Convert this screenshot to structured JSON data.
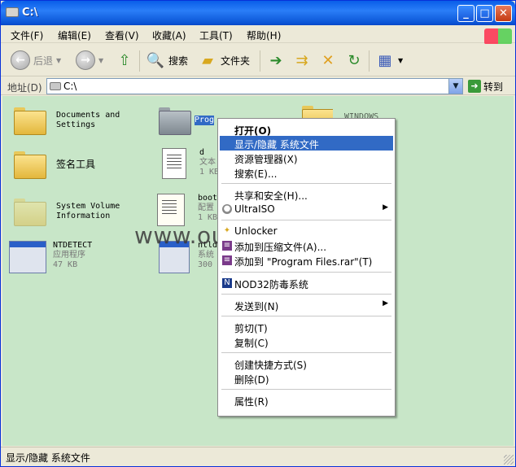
{
  "window": {
    "title": "C:\\",
    "minimize": "_",
    "maximize": "□",
    "close": "✕"
  },
  "menu": [
    "文件(F)",
    "编辑(E)",
    "查看(V)",
    "收藏(A)",
    "工具(T)",
    "帮助(H)"
  ],
  "toolbar": {
    "back": "后退",
    "search": "搜索",
    "folders": "文件夹"
  },
  "address": {
    "label": "地址(D)",
    "value": "C:\\",
    "go": "转到"
  },
  "items": [
    {
      "name": "Documents and Settings",
      "line1": "Documents and",
      "line2": "Settings"
    },
    {
      "name": "Program Files",
      "line1": "Prog"
    },
    {
      "name": "WINDOWS",
      "line1": "WINDOWS"
    },
    {
      "name": "签名工具",
      "line1": "签名工具"
    },
    {
      "name": "d",
      "line1": "d",
      "line2": "文本",
      "line3": "1 KB"
    },
    {
      "name": "System Volume Information",
      "line1": "System Volume",
      "line2": "Information"
    },
    {
      "name": "boot",
      "line1": "boot",
      "line2": "配置",
      "line3": "1 KB"
    },
    {
      "name": "NTDETECT",
      "line1": "NTDETECT",
      "line2": "应用程序",
      "line3": "47 KB"
    },
    {
      "name": "ntldr",
      "line1": "ntld",
      "line2": "系统",
      "line3": "300"
    }
  ],
  "watermark": "www.ouyaoxiazai.com",
  "context_menu": [
    {
      "label": "打开(O)",
      "bold": true
    },
    {
      "label": "显示/隐藏 系统文件",
      "highlighted": true
    },
    {
      "label": "资源管理器(X)"
    },
    {
      "label": "搜索(E)..."
    },
    {
      "sep": true
    },
    {
      "label": "共享和安全(H)..."
    },
    {
      "label": "UltraISO",
      "submenu": true,
      "icon": "ultraiso-icon"
    },
    {
      "sep": true
    },
    {
      "label": "Unlocker",
      "icon": "unlocker-icon"
    },
    {
      "label": "添加到压缩文件(A)...",
      "icon": "winrar-icon"
    },
    {
      "label": "添加到 \"Program Files.rar\"(T)",
      "icon": "winrar-icon"
    },
    {
      "sep": true
    },
    {
      "label": "NOD32防毒系统",
      "icon": "nod32-icon"
    },
    {
      "sep": true
    },
    {
      "label": "发送到(N)",
      "submenu": true
    },
    {
      "sep": true
    },
    {
      "label": "剪切(T)"
    },
    {
      "label": "复制(C)"
    },
    {
      "sep": true
    },
    {
      "label": "创建快捷方式(S)"
    },
    {
      "label": "删除(D)"
    },
    {
      "sep": true
    },
    {
      "label": "属性(R)"
    }
  ],
  "status": "显示/隐藏 系统文件",
  "colors": {
    "content_bg": "#c8e6c8",
    "highlight": "#316ac5",
    "titlebar": "#0a5ee8"
  }
}
